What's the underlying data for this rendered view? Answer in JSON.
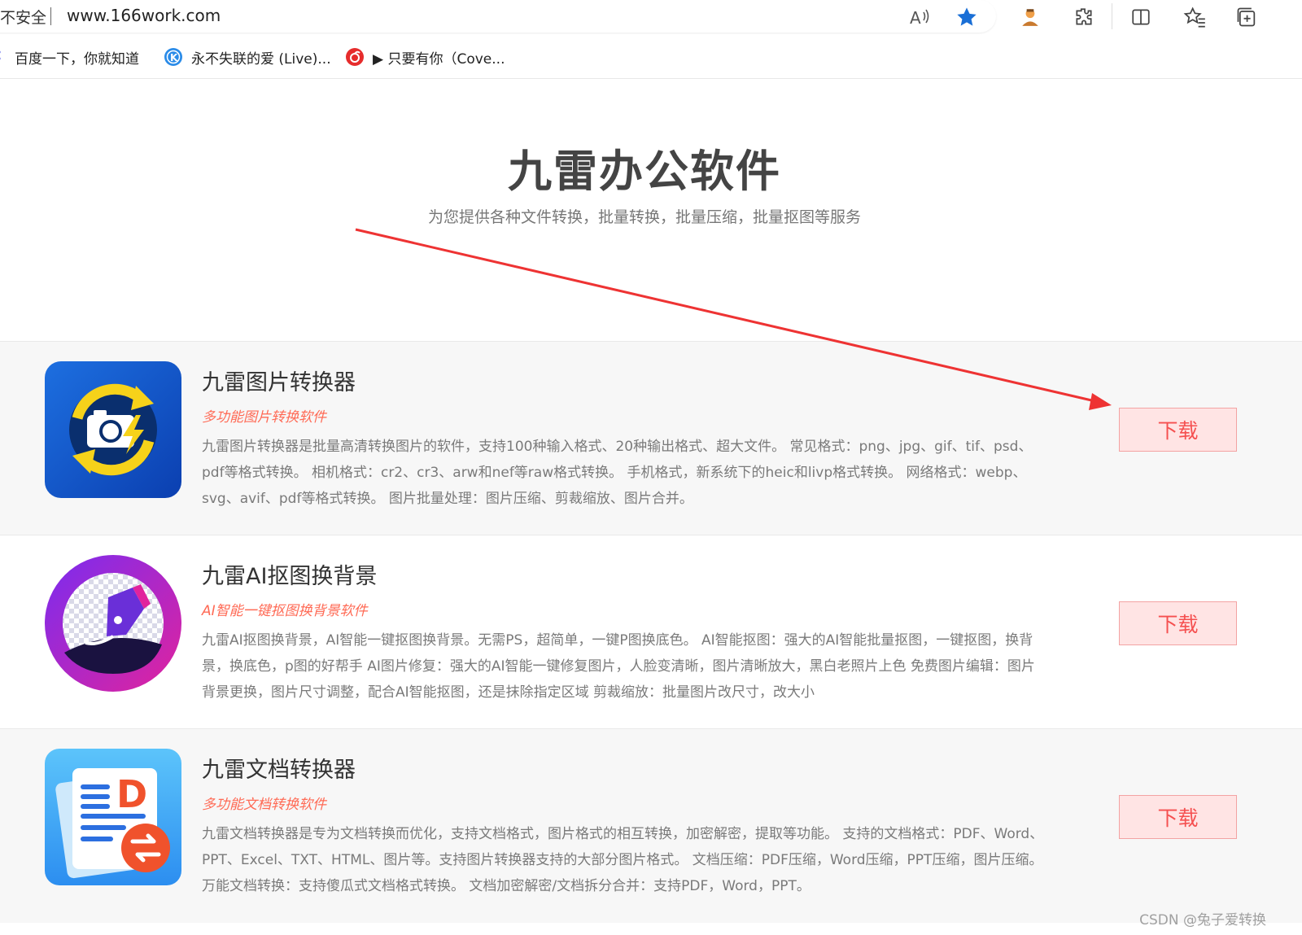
{
  "browser": {
    "security_label": "不安全",
    "url": "www.166work.com",
    "toolbar_icons": [
      "read-aloud-icon",
      "favorite-star-icon",
      "profile-icon",
      "extensions-icon",
      "split-screen-icon",
      "favorites-icon",
      "collections-icon"
    ],
    "favorites": [
      {
        "label": "百度一下，你就知道",
        "icon": "baidu-icon"
      },
      {
        "label": "永不失联的爱 (Live)...",
        "icon": "kugou-icon"
      },
      {
        "label": "▶ 只要有你（Cove...",
        "icon": "netease-music-icon"
      }
    ]
  },
  "hero": {
    "title": "九雷办公软件",
    "subtitle": "为您提供各种文件转换，批量转换，批量压缩，批量抠图等服务"
  },
  "products": [
    {
      "name": "九雷图片转换器",
      "tagline": "多功能图片转换软件",
      "description": "九雷图片转换器是批量高清转换图片的软件，支持100种输入格式、20种输出格式、超大文件。 常见格式：png、jpg、gif、tif、psd、pdf等格式转换。 相机格式：cr2、cr3、arw和nef等raw格式转换。 手机格式，新系统下的heic和livp格式转换。 网络格式：webp、svg、avif、pdf等格式转换。 图片批量处理：图片压缩、剪裁缩放、图片合并。",
      "download_label": "下载"
    },
    {
      "name": "九雷AI抠图换背景",
      "tagline": "AI智能一键抠图换背景软件",
      "description": "九雷AI抠图换背景，AI智能一键抠图换背景。无需PS，超简单，一键P图换底色。 AI智能抠图：强大的AI智能批量抠图，一键抠图，换背景，换底色，p图的好帮手 AI图片修复：强大的AI智能一键修复图片，人脸变清晰，图片清晰放大，黑白老照片上色 免费图片编辑：图片背景更换，图片尺寸调整，配合AI智能抠图，还是抹除指定区域 剪裁缩放：批量图片改尺寸，改大小",
      "download_label": "下载"
    },
    {
      "name": "九雷文档转换器",
      "tagline": "多功能文档转换软件",
      "description": "九雷文档转换器是专为文档转换而优化，支持文档格式，图片格式的相互转换，加密解密，提取等功能。 支持的文档格式：PDF、Word、PPT、Excel、TXT、HTML、图片等。支持图片转换器支持的大部分图片格式。 文档压缩：PDF压缩，Word压缩，PPT压缩，图片压缩。 万能文档转换：支持傻瓜式文档格式转换。 文档加密解密/文档拆分合并：支持PDF，Word，PPT。",
      "download_label": "下载"
    }
  ],
  "annotation": {
    "arrow_color": "#ee3333"
  },
  "watermark": "CSDN @兔子爱转换",
  "colors": {
    "accent": "#f55050",
    "tagline": "#ff6a55",
    "button_bg": "#ffe4e4"
  }
}
